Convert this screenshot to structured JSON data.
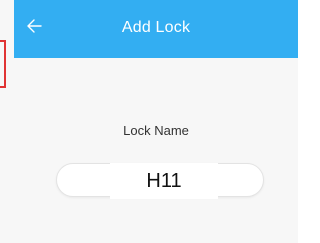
{
  "header": {
    "title": "Add Lock",
    "back_icon": "arrow-left-icon",
    "bg_color": "#33aef2"
  },
  "form": {
    "lock_name_label": "Lock Name",
    "lock_name_value": "H11"
  }
}
